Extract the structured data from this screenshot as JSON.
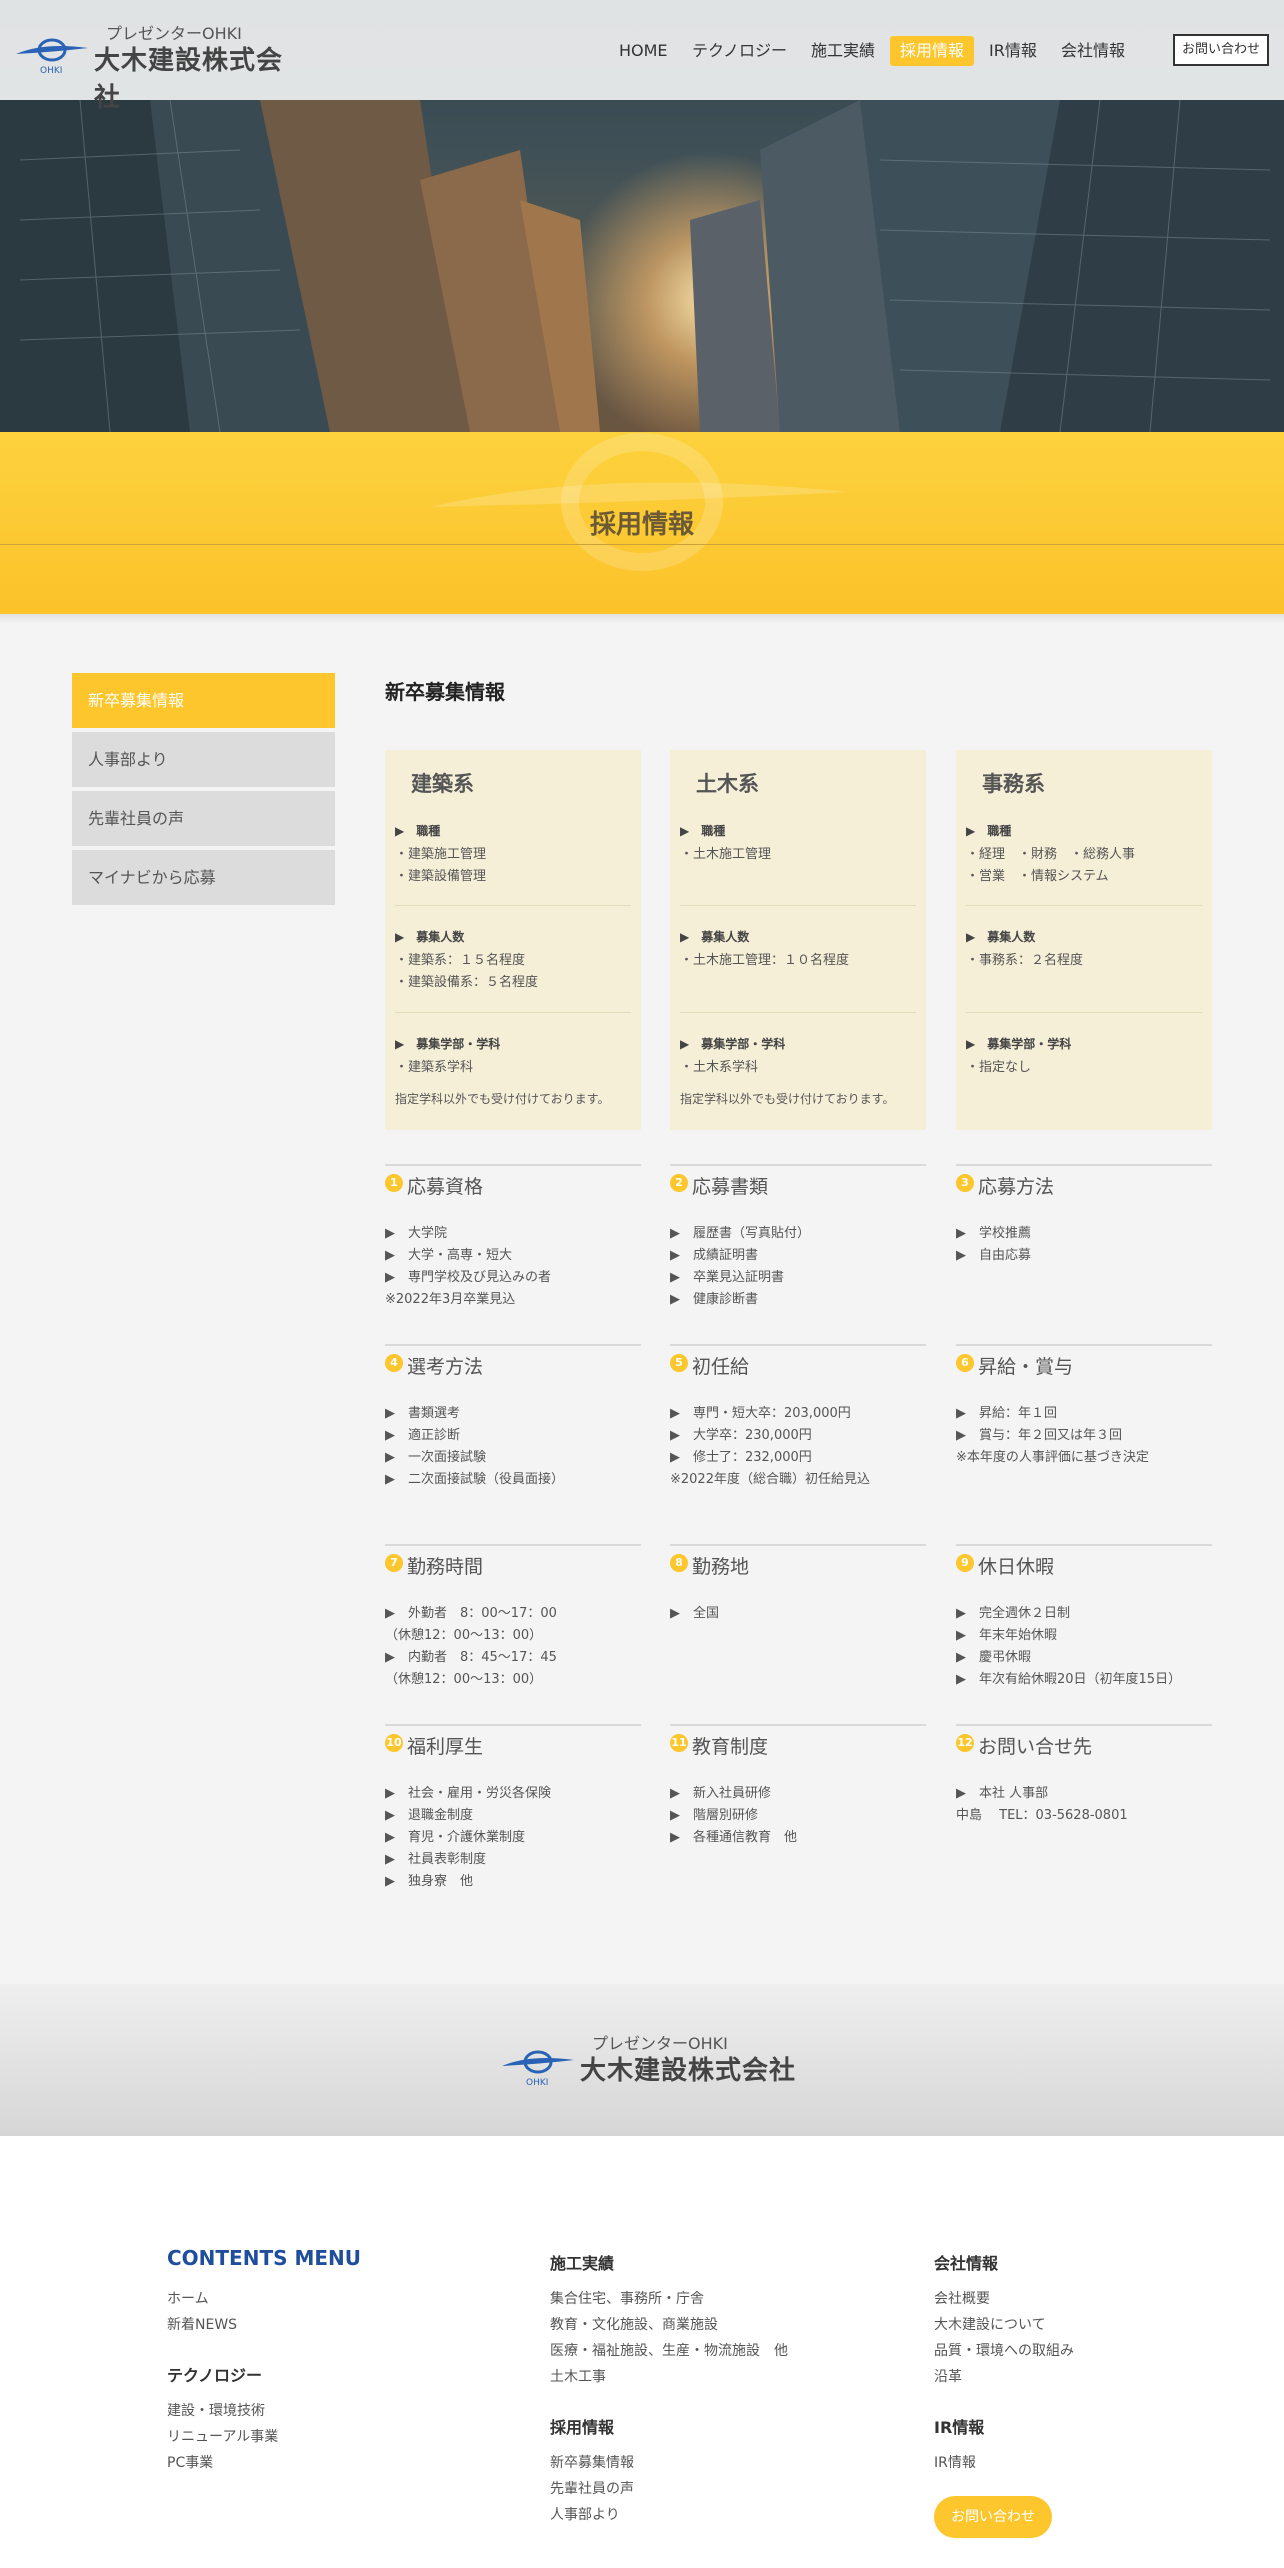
{
  "header": {
    "logo_sub": "プレゼンターOHKI",
    "logo_name": "大木建設株式会社",
    "logo_mark": "OHKI",
    "nav": [
      "HOME",
      "テクノロジー",
      "施工実績",
      "採用情報",
      "IR情報",
      "会社情報"
    ],
    "contact": "お問い合わせ"
  },
  "banner": {
    "title": "採用情報"
  },
  "sidebar": {
    "items": [
      "新卒募集情報",
      "人事部より",
      "先輩社員の声",
      "マイナビから応募"
    ]
  },
  "main": {
    "title": "新卒募集情報",
    "cards": [
      {
        "title": "建築系",
        "job_head": "職種",
        "jobs": [
          "・建築施工管理",
          "・建築設備管理"
        ],
        "count_head": "募集人数",
        "counts": [
          "・建築系：１５名程度",
          "・建築設備系：５名程度"
        ],
        "dept_head": "募集学部・学科",
        "depts": [
          "・建築系学科"
        ],
        "note": "指定学科以外でも受け付けております。"
      },
      {
        "title": "土木系",
        "job_head": "職種",
        "jobs": [
          "・土木施工管理"
        ],
        "count_head": "募集人数",
        "counts": [
          "・土木施工管理：１０名程度"
        ],
        "dept_head": "募集学部・学科",
        "depts": [
          "・土木系学科"
        ],
        "note": "指定学科以外でも受け付けております。"
      },
      {
        "title": "事務系",
        "job_head": "職種",
        "jobs": [
          "・経理　・財務　・総務人事",
          "・営業　・情報システム"
        ],
        "count_head": "募集人数",
        "counts": [
          "・事務系：２名程度"
        ],
        "dept_head": "募集学部・学科",
        "depts": [
          "・指定なし"
        ],
        "note": ""
      }
    ],
    "info": [
      {
        "num": "1",
        "title": "応募資格",
        "lines": [
          "▶　大学院",
          "▶　大学・高専・短大",
          "▶　専門学校及び見込みの者",
          "※2022年3月卒業見込"
        ]
      },
      {
        "num": "2",
        "title": "応募書類",
        "lines": [
          "▶　履歴書（写真貼付）",
          "▶　成績証明書",
          "▶　卒業見込証明書",
          "▶　健康診断書"
        ]
      },
      {
        "num": "3",
        "title": "応募方法",
        "lines": [
          "▶　学校推薦",
          "▶　自由応募"
        ]
      },
      {
        "num": "4",
        "title": "選考方法",
        "lines": [
          "▶　書類選考",
          "▶　適正診断",
          "▶　一次面接試験",
          "▶　二次面接試験（役員面接）"
        ]
      },
      {
        "num": "5",
        "title": "初任給",
        "lines": [
          "▶　専門・短大卒：203,000円",
          "▶　大学卒：230,000円",
          "▶　修士了：232,000円",
          "※2022年度（総合職）初任給見込"
        ]
      },
      {
        "num": "6",
        "title": "昇給・賞与",
        "lines": [
          "▶　昇給：年１回",
          "▶　賞与：年２回又は年３回",
          "※本年度の人事評価に基づき決定"
        ]
      },
      {
        "num": "7",
        "title": "勤務時間",
        "lines": [
          "▶　外勤者　8：00〜17：00",
          "（休憩12：00〜13：00）",
          "▶　内勤者　8：45〜17：45",
          "（休憩12：00〜13：00）"
        ]
      },
      {
        "num": "8",
        "title": "勤務地",
        "lines": [
          "▶　全国"
        ]
      },
      {
        "num": "9",
        "title": "休日休暇",
        "lines": [
          "▶　完全週休２日制",
          "▶　年末年始休暇",
          "▶　慶弔休暇",
          "▶　年次有給休暇20日（初年度15日）"
        ]
      },
      {
        "num": "10",
        "title": "福利厚生",
        "lines": [
          "▶　社会・雇用・労災各保険",
          "▶　退職金制度",
          "▶　育児・介護休業制度",
          "▶　社員表彰制度",
          "▶　独身寮　他"
        ]
      },
      {
        "num": "11",
        "title": "教育制度",
        "lines": [
          "▶　新入社員研修",
          "▶　階層別研修",
          "▶　各種通信教育　他"
        ]
      },
      {
        "num": "12",
        "title": "お問い合せ先",
        "lines": [
          "▶　本社 人事部",
          "中島　 TEL：03-5628-0801"
        ]
      }
    ]
  },
  "footer": {
    "logo_sub": "プレゼンターOHKI",
    "logo_name": "大木建設株式会社",
    "logo_mark": "OHKI",
    "contents_menu": "CONTENTS MENU",
    "col1_links": [
      "ホーム",
      "新着NEWS"
    ],
    "col1_head2": "テクノロジー",
    "col1_links2": [
      "建設・環境技術",
      "リニューアル事業",
      "PC事業"
    ],
    "col2_head": "施工実績",
    "col2_links": [
      "集合住宅、事務所・庁舎",
      "教育・文化施設、商業施設",
      "医療・福祉施設、生産・物流施設　他",
      "土木工事"
    ],
    "col2_head2": "採用情報",
    "col2_links2": [
      "新卒募集情報",
      "先輩社員の声",
      "人事部より"
    ],
    "col3_head": "会社情報",
    "col3_links": [
      "会社概要",
      "大木建設について",
      "品質・環境への取組み",
      "沿革"
    ],
    "col3_head2": "IR情報",
    "col3_links2": [
      "IR情報"
    ],
    "contact": "お問い合わせ"
  },
  "colors": {
    "accent": "#fcc62c",
    "brand_blue": "#1f4e9c",
    "card_bg": "#f6efd8"
  }
}
